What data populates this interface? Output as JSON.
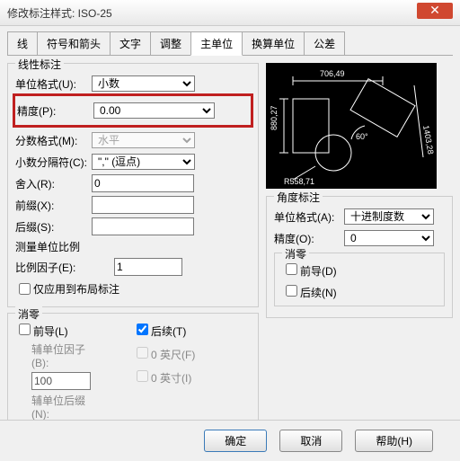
{
  "title": "修改标注样式: ISO-25",
  "tabs": [
    "线",
    "符号和箭头",
    "文字",
    "调整",
    "主单位",
    "换算单位",
    "公差"
  ],
  "activeTab": 4,
  "linear": {
    "legend": "线性标注",
    "unitFormatLabel": "单位格式(U):",
    "unitFormat": "小数",
    "precisionLabel": "精度(P):",
    "precision": "0.00",
    "fracFormatLabel": "分数格式(M):",
    "fracFormat": "水平",
    "decSepLabel": "小数分隔符(C):",
    "decSep": "\",\" (逗点)",
    "roundLabel": "舍入(R):",
    "round": "0",
    "prefixLabel": "前缀(X):",
    "prefix": "",
    "suffixLabel": "后缀(S):",
    "suffix": ""
  },
  "measure": {
    "legend": "测量单位比例",
    "scaleLabel": "比例因子(E):",
    "scale": "1",
    "layoutOnly": "仅应用到布局标注"
  },
  "zero": {
    "legend": "消零",
    "leading": "前导(L)",
    "trailing": "后续(T)",
    "subFactorLabel": "辅单位因子(B):",
    "subFactor": "100",
    "subSuffixLabel": "辅单位后缀(N):",
    "subSuffix": "",
    "feet": "0 英尺(F)",
    "inch": "0 英寸(I)"
  },
  "angle": {
    "legend": "角度标注",
    "unitLabel": "单位格式(A):",
    "unit": "十进制度数",
    "precLabel": "精度(O):",
    "prec": "0",
    "zeroLegend": "消零",
    "leading": "前导(D)",
    "trailing": "后续(N)"
  },
  "preview": {
    "dim1": "706,49",
    "dim2": "880,27",
    "dim3": "1403,28",
    "ang": "60°",
    "rad": "R558,71"
  },
  "buttons": {
    "ok": "确定",
    "cancel": "取消",
    "help": "帮助(H)"
  }
}
